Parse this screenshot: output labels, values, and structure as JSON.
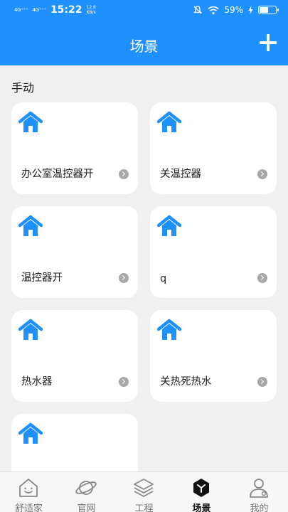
{
  "status_bar": {
    "signal_1": "4G⁺⁺⁺",
    "signal_2": "4G⁺⁺⁺",
    "time": "15:22",
    "speed_value": "12.6",
    "speed_unit": "KB/s",
    "battery_text": "59%",
    "battery_level": 0.59
  },
  "header": {
    "title": "场景",
    "add_icon": "plus-icon"
  },
  "section": {
    "title": "手动"
  },
  "scenes": [
    {
      "label": "办公室温控器开",
      "icon": "home-icon"
    },
    {
      "label": "关温控器",
      "icon": "home-icon"
    },
    {
      "label": "温控器开",
      "icon": "home-icon"
    },
    {
      "label": "q",
      "icon": "home-icon"
    },
    {
      "label": "热水器",
      "icon": "home-icon"
    },
    {
      "label": "关热死热水",
      "icon": "home-icon"
    },
    {
      "label": "",
      "icon": "home-icon"
    }
  ],
  "tabbar": {
    "items": [
      {
        "label": "舒适家",
        "icon": "smile-home-icon",
        "active": false
      },
      {
        "label": "官网",
        "icon": "planet-icon",
        "active": false
      },
      {
        "label": "工程",
        "icon": "layers-icon",
        "active": false
      },
      {
        "label": "场景",
        "icon": "scene-hexagon-icon",
        "active": true
      },
      {
        "label": "我的",
        "icon": "profile-icon",
        "active": false
      }
    ]
  },
  "colors": {
    "primary": "#1e90ff",
    "background": "#f0f0f0",
    "card": "#ffffff",
    "icon_blue": "#1e90ff"
  }
}
